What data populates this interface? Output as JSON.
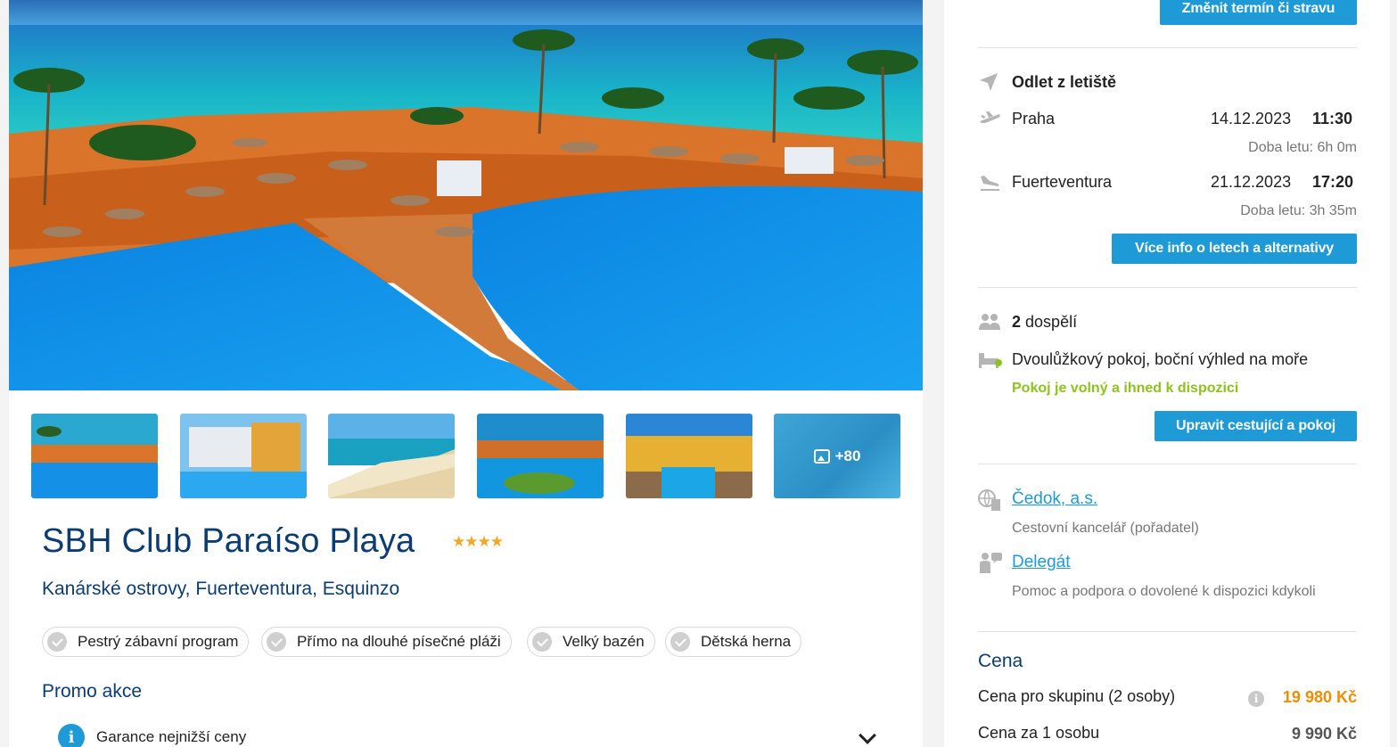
{
  "gallery": {
    "more_label": "+80"
  },
  "hotel": {
    "name": "SBH Club Paraíso Playa",
    "stars": "★★★★",
    "location": "Kanárské ostrovy, Fuerteventura, Esquinzo"
  },
  "tags": [
    "Pestrý zábavní program",
    "Přímo na dlouhé písečné pláži",
    "Velký bazén",
    "Dětská herna"
  ],
  "promo": {
    "title": "Promo akce",
    "item": "Garance nejnižší ceny"
  },
  "sidebar": {
    "change_button": "Změnit termín či stravu",
    "flight": {
      "heading": "Odlet z letiště",
      "outbound": {
        "city": "Praha",
        "date": "14.12.2023",
        "time": "11:30",
        "duration": "Doba letu: 6h 0m"
      },
      "inbound": {
        "city": "Fuerteventura",
        "date": "21.12.2023",
        "time": "17:20",
        "duration": "Doba letu: 3h 35m"
      },
      "more_button": "Více info o letech a alternativy"
    },
    "travellers": {
      "count": "2",
      "label": "dospělí",
      "room": "Dvoulůžkový pokoj, boční výhled na moře",
      "availability": "Pokoj je volný a ihned k dispozici",
      "edit_button": "Upravit cestující a pokoj"
    },
    "agency": {
      "name": "Čedok, a.s.",
      "desc": "Cestovní kancelář (pořadatel)"
    },
    "delegate": {
      "name": "Delegát",
      "desc": "Pomoc a podpora o dovolené k dispozici kdykoli"
    },
    "price": {
      "title": "Cena",
      "group_label": "Cena pro skupinu (2 osoby)",
      "group_value": "19 980 Kč",
      "person_label": "Cena za 1 osobu",
      "person_value": "9 990 Kč"
    }
  },
  "colors": {
    "accent": "#1e9ad6",
    "title": "#0c3c72",
    "price": "#f08c00",
    "available": "#8dc21f"
  }
}
